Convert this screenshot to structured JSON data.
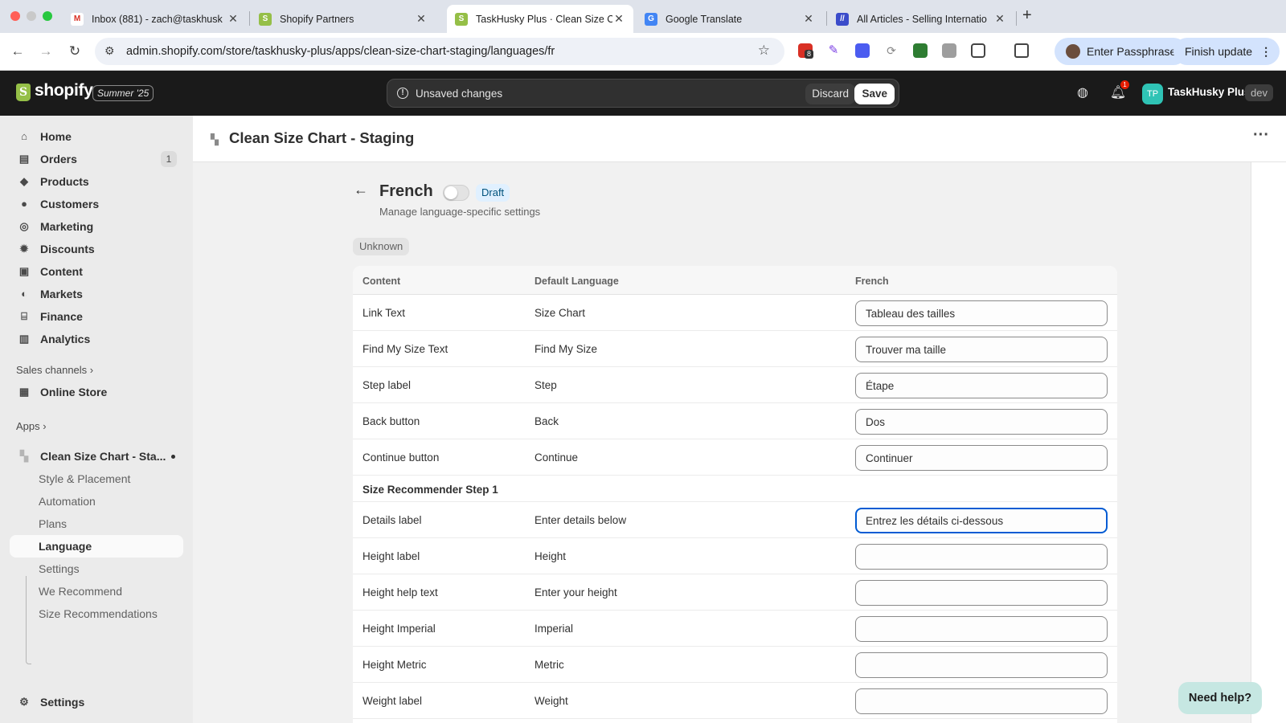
{
  "browser": {
    "tabs": [
      {
        "title": "Inbox (881) - zach@taskhusk",
        "favicon": "gmail-icon",
        "color": "#d93025"
      },
      {
        "title": "Shopify Partners",
        "favicon": "shopify-icon",
        "color": "#95bf47"
      },
      {
        "title": "TaskHusky Plus · Clean Size C",
        "favicon": "shopify-icon",
        "color": "#95bf47"
      },
      {
        "title": "Google Translate",
        "favicon": "google-translate-icon",
        "color": "#4285f4"
      },
      {
        "title": "All Articles - Selling Internatio",
        "favicon": "article-icon",
        "color": "#3b4cca"
      }
    ],
    "url": "admin.shopify.com/store/taskhusky-plus/apps/clean-size-chart-staging/languages/fr",
    "extension_badge": "8",
    "profile_button": "Enter Passphrase",
    "update_button": "Finish update"
  },
  "topbar": {
    "logo": "shopify",
    "edition": "Summer '25",
    "unsaved_message": "Unsaved changes",
    "discard_label": "Discard",
    "save_label": "Save",
    "notification_count": "1",
    "avatar_initials": "TP",
    "store_name": "TaskHusky Plus",
    "env_badge": "dev"
  },
  "sidebar": {
    "items": [
      {
        "label": "Home",
        "icon": "home-icon"
      },
      {
        "label": "Orders",
        "icon": "orders-icon",
        "count": "1"
      },
      {
        "label": "Products",
        "icon": "tag-icon"
      },
      {
        "label": "Customers",
        "icon": "person-icon"
      },
      {
        "label": "Marketing",
        "icon": "target-icon"
      },
      {
        "label": "Discounts",
        "icon": "discount-icon"
      },
      {
        "label": "Content",
        "icon": "content-icon"
      },
      {
        "label": "Markets",
        "icon": "globe-icon"
      },
      {
        "label": "Finance",
        "icon": "bank-icon"
      },
      {
        "label": "Analytics",
        "icon": "chart-icon"
      }
    ],
    "sales_channels_label": "Sales channels",
    "online_store_label": "Online Store",
    "apps_label": "Apps",
    "app_name": "Clean Size Chart - Sta...",
    "app_subitems": [
      "Style & Placement",
      "Automation",
      "Plans",
      "Language",
      "Settings",
      "We Recommend",
      "Size Recommendations"
    ],
    "active_subitem": "Language",
    "settings_label": "Settings"
  },
  "main": {
    "app_title": "Clean Size Chart - Staging",
    "language_title": "French",
    "status_badge": "Draft",
    "subtitle": "Manage language-specific settings",
    "unknown_badge": "Unknown",
    "table": {
      "headers": [
        "Content",
        "Default Language",
        "French"
      ],
      "rows_group1": [
        {
          "content": "Link Text",
          "default": "Size Chart",
          "french": "Tableau des tailles"
        },
        {
          "content": "Find My Size Text",
          "default": "Find My Size",
          "french": "Trouver ma taille"
        },
        {
          "content": "Step label",
          "default": "Step",
          "french": "Étape"
        },
        {
          "content": "Back button",
          "default": "Back",
          "french": "Dos"
        },
        {
          "content": "Continue button",
          "default": "Continue",
          "french": "Continuer"
        }
      ],
      "section_title": "Size Recommender Step 1",
      "rows_group2": [
        {
          "content": "Details label",
          "default": "Enter details below",
          "french": "Entrez les détails ci-dessous"
        },
        {
          "content": "Height label",
          "default": "Height",
          "french": ""
        },
        {
          "content": "Height help text",
          "default": "Enter your height",
          "french": ""
        },
        {
          "content": "Height Imperial",
          "default": "Imperial",
          "french": ""
        },
        {
          "content": "Height Metric",
          "default": "Metric",
          "french": ""
        },
        {
          "content": "Weight label",
          "default": "Weight",
          "french": ""
        }
      ]
    }
  },
  "help_button": "Need help?",
  "colors": {
    "topbar": "#1a1a1a",
    "focus_ring": "#005bd3",
    "draft_badge_bg": "#e0f0ff",
    "shopify_green": "#95bf47"
  }
}
